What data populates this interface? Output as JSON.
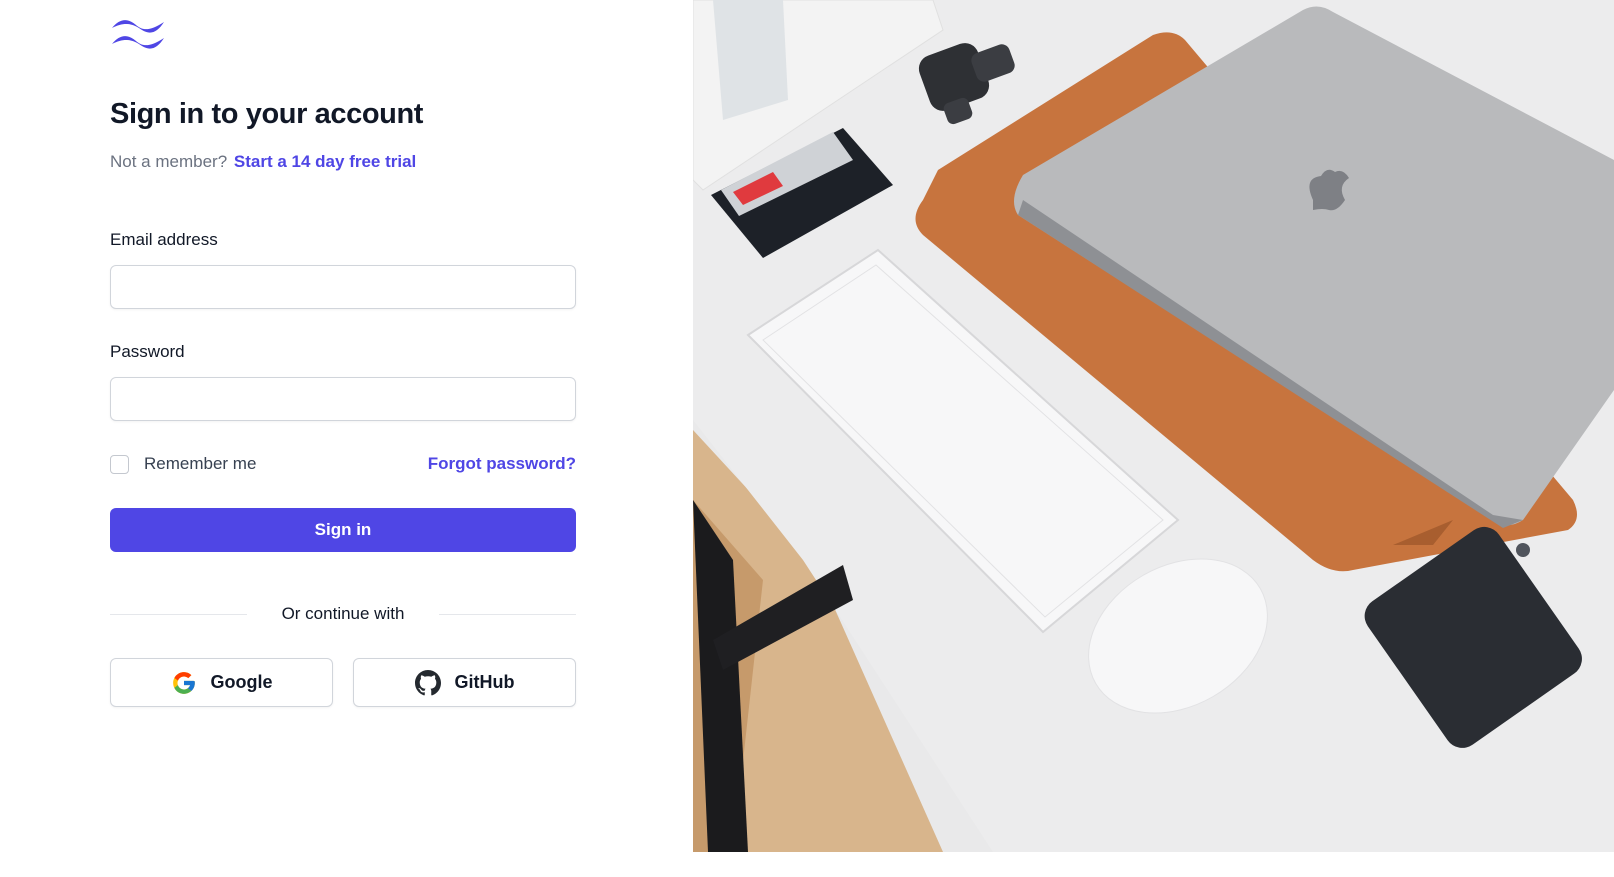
{
  "brand": {
    "accent": "#4f46e5",
    "logo_icon": "tailwind-wave-logo"
  },
  "header": {
    "title": "Sign in to your account",
    "subtitle_prefix": "Not a member?",
    "trial_link": "Start a 14 day free trial"
  },
  "form": {
    "email_label": "Email address",
    "email_value": "",
    "password_label": "Password",
    "password_value": "",
    "remember_label": "Remember me",
    "remember_checked": false,
    "forgot_link": "Forgot password?",
    "submit_label": "Sign in"
  },
  "social": {
    "divider_text": "Or continue with",
    "providers": [
      {
        "label": "Google",
        "icon": "google-icon"
      },
      {
        "label": "GitHub",
        "icon": "github-icon"
      }
    ]
  },
  "hero": {
    "image": "desk-photo",
    "colors": {
      "desk": "#ececed",
      "sleeve": "#c7743e",
      "laptop": "#b9babc",
      "phone": "#2a2d33"
    }
  }
}
